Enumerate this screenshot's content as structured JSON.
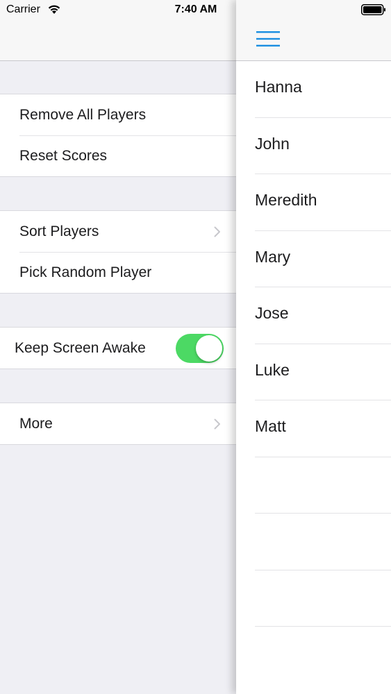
{
  "status_bar": {
    "carrier": "Carrier",
    "time": "7:40 AM"
  },
  "colors": {
    "accent": "#1a8ee1",
    "toggle_on": "#4cd964",
    "background": "#efeff4",
    "separator": "#e3e3e6"
  },
  "menu": {
    "group1": {
      "remove_all": "Remove All Players",
      "reset_scores": "Reset Scores"
    },
    "group2": {
      "sort_players": "Sort Players",
      "pick_random": "Pick Random Player"
    },
    "group3": {
      "keep_awake": "Keep Screen Awake",
      "keep_awake_on": true
    },
    "group4": {
      "more": "More"
    }
  },
  "main": {
    "menu_icon": "hamburger-icon",
    "players": [
      {
        "name": "Hanna"
      },
      {
        "name": "John"
      },
      {
        "name": "Meredith"
      },
      {
        "name": "Mary"
      },
      {
        "name": "Jose"
      },
      {
        "name": "Luke"
      },
      {
        "name": "Matt"
      }
    ]
  }
}
